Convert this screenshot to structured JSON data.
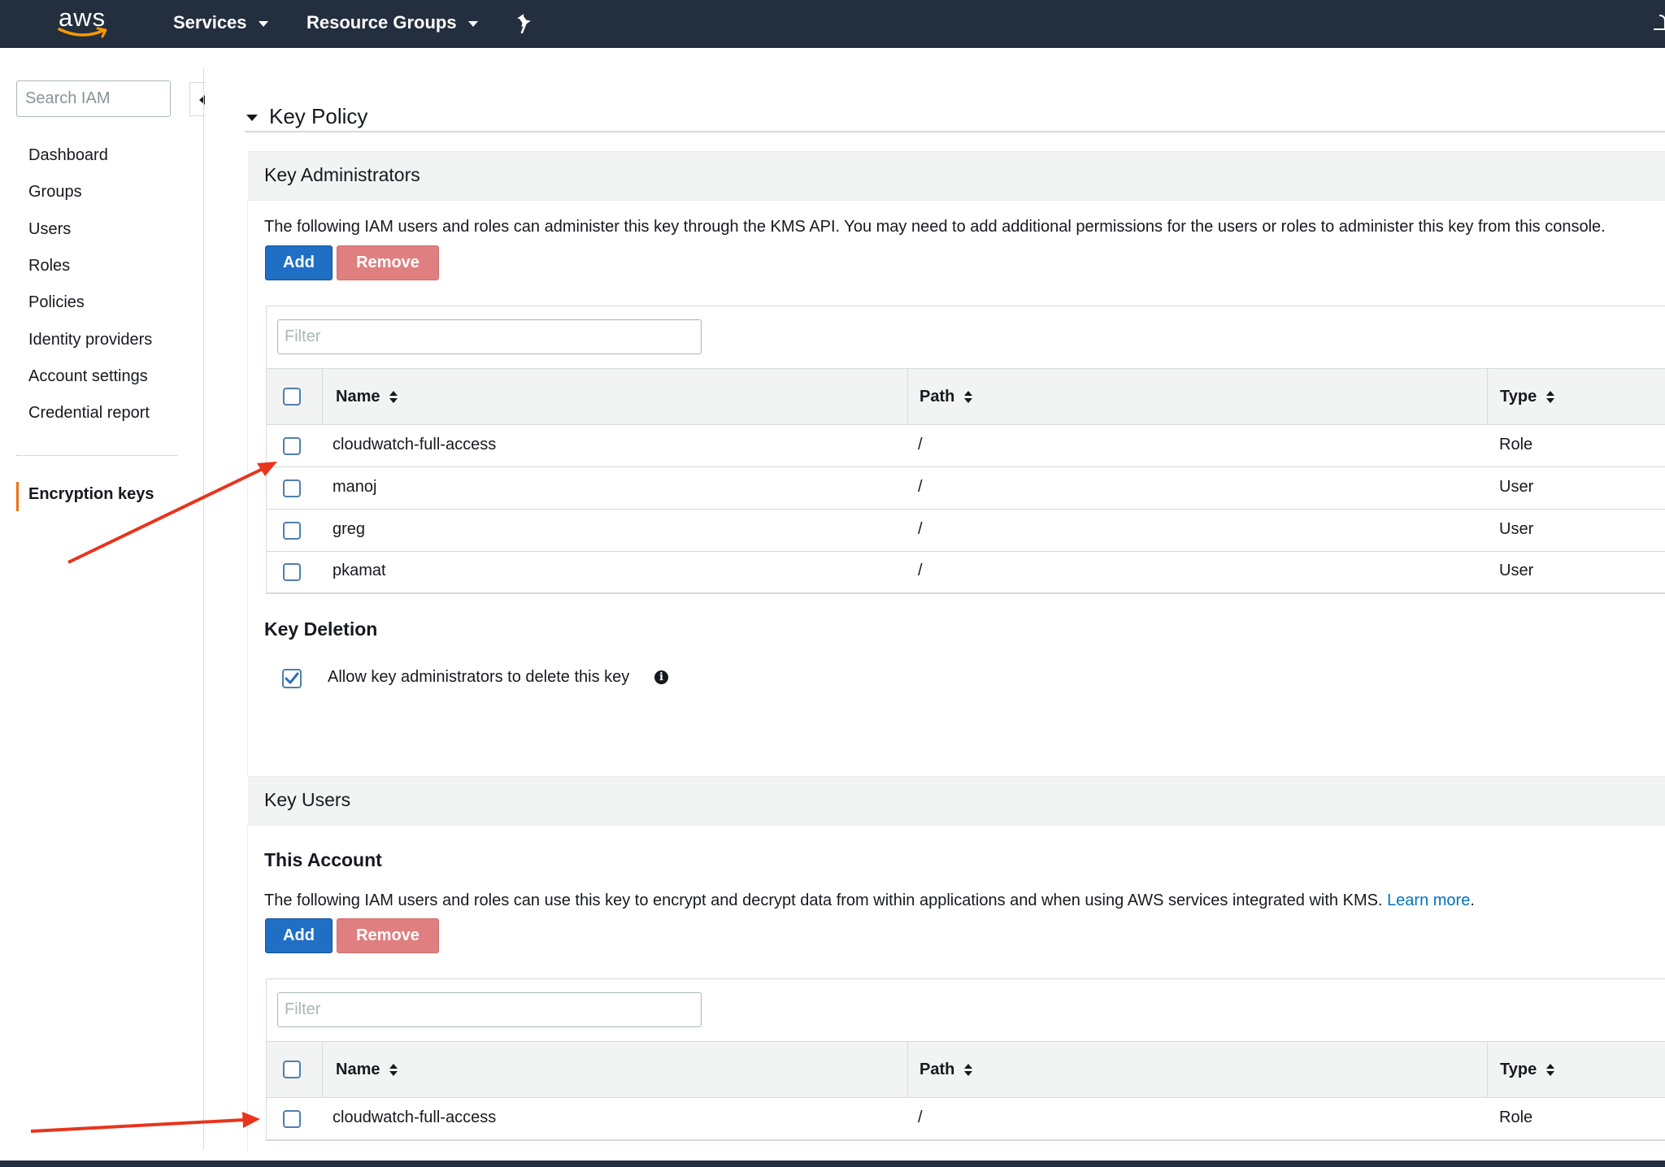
{
  "topnav": {
    "logo": "aws",
    "services_label": "Services",
    "resource_groups_label": "Resource Groups"
  },
  "sidebar": {
    "search_placeholder": "Search IAM",
    "items": [
      {
        "label": "Dashboard"
      },
      {
        "label": "Groups"
      },
      {
        "label": "Users"
      },
      {
        "label": "Roles"
      },
      {
        "label": "Policies"
      },
      {
        "label": "Identity providers"
      },
      {
        "label": "Account settings"
      },
      {
        "label": "Credential report"
      }
    ],
    "active_item": "Encryption keys"
  },
  "key_policy": {
    "title": "Key Policy",
    "administrators": {
      "title": "Key Administrators",
      "description": "The following IAM users and roles can administer this key through the KMS API. You may need to add additional permissions for the users or roles to administer this key from this console.",
      "add_label": "Add",
      "remove_label": "Remove",
      "filter_placeholder": "Filter",
      "columns": [
        "Name",
        "Path",
        "Type"
      ],
      "rows": [
        {
          "name": "cloudwatch-full-access",
          "path": "/",
          "type": "Role"
        },
        {
          "name": "manoj",
          "path": "/",
          "type": "User"
        },
        {
          "name": "greg",
          "path": "/",
          "type": "User"
        },
        {
          "name": "pkamat",
          "path": "/",
          "type": "User"
        }
      ]
    },
    "deletion": {
      "title": "Key Deletion",
      "checkbox_label": "Allow key administrators to delete this key",
      "checked": true
    },
    "users": {
      "title": "Key Users",
      "subtitle": "This Account",
      "description": "The following IAM users and roles can use this key to encrypt and decrypt data from within applications and when using AWS services integrated with KMS.",
      "learn_more": "Learn more",
      "description_end": ".",
      "add_label": "Add",
      "remove_label": "Remove",
      "filter_placeholder": "Filter",
      "columns": [
        "Name",
        "Path",
        "Type"
      ],
      "rows": [
        {
          "name": "cloudwatch-full-access",
          "path": "/",
          "type": "Role"
        }
      ]
    }
  },
  "colors": {
    "nav_bg": "#232f3e",
    "add_button": "#1f6fc5",
    "remove_button": "#e07f7f",
    "active_accent": "#ec7211",
    "annotation_arrow": "#e8341c",
    "link": "#0073bb"
  }
}
